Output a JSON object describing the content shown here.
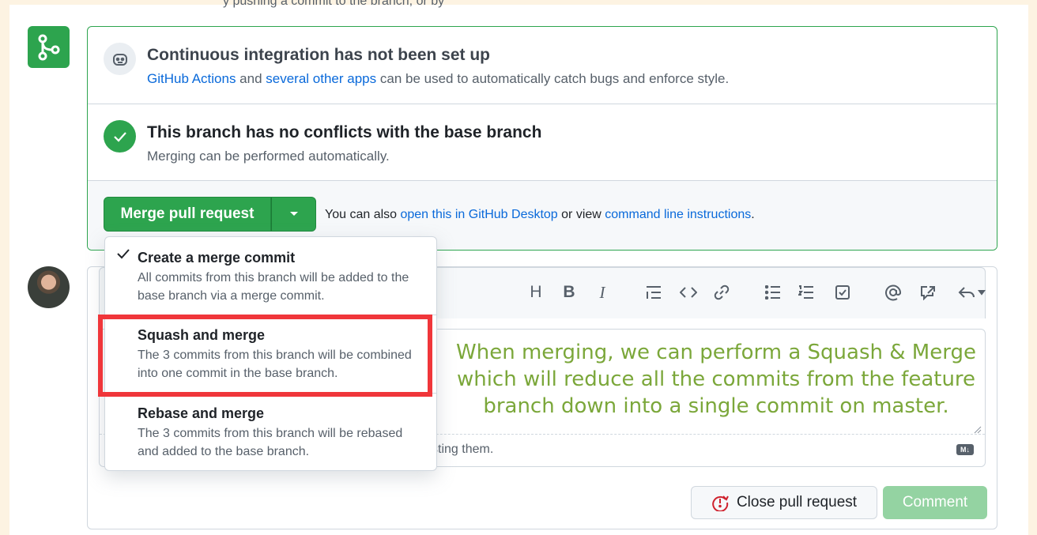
{
  "top_clip_text": "y pushing a commit to the branch, or by",
  "checks": {
    "ci_title": "Continuous integration has not been set up",
    "ci_link1": "GitHub Actions",
    "ci_mid": " and ",
    "ci_link2": "several other apps",
    "ci_tail": " can be used to automatically catch bugs and enforce style.",
    "conflicts_title": "This branch has no conflicts with the base branch",
    "conflicts_sub": "Merging can be performed automatically."
  },
  "merge": {
    "button_label": "Merge pull request",
    "also_prefix": "You can also ",
    "desktop_link": "open this in GitHub Desktop",
    "also_mid": " or view ",
    "cli_link": "command line instructions",
    "also_end": "."
  },
  "dropdown": {
    "options": [
      {
        "title": "Create a merge commit",
        "desc": "All commits from this branch will be added to the base branch via a merge commit.",
        "selected": true
      },
      {
        "title": "Squash and merge",
        "desc": "The 3 commits from this branch will be combined into one commit in the base branch.",
        "selected": false
      },
      {
        "title": "Rebase and merge",
        "desc": "The 3 commits from this branch will be rebased and added to the base branch.",
        "selected": false
      }
    ]
  },
  "comment": {
    "toolbar": [
      "H",
      "B",
      "I"
    ],
    "footer_text": "sting them.",
    "md_badge": "M↓",
    "close_label": "Close pull request",
    "comment_label": "Comment"
  },
  "annotation": "When merging, we can perform a Squash & Merge which will reduce all the commits from the feature branch down into a single commit on master.",
  "colors": {
    "success": "#2da44e",
    "link": "#0969da",
    "annotation": "#7ba73a",
    "highlight": "#f0363a",
    "page_bg": "#fdf3e2"
  }
}
